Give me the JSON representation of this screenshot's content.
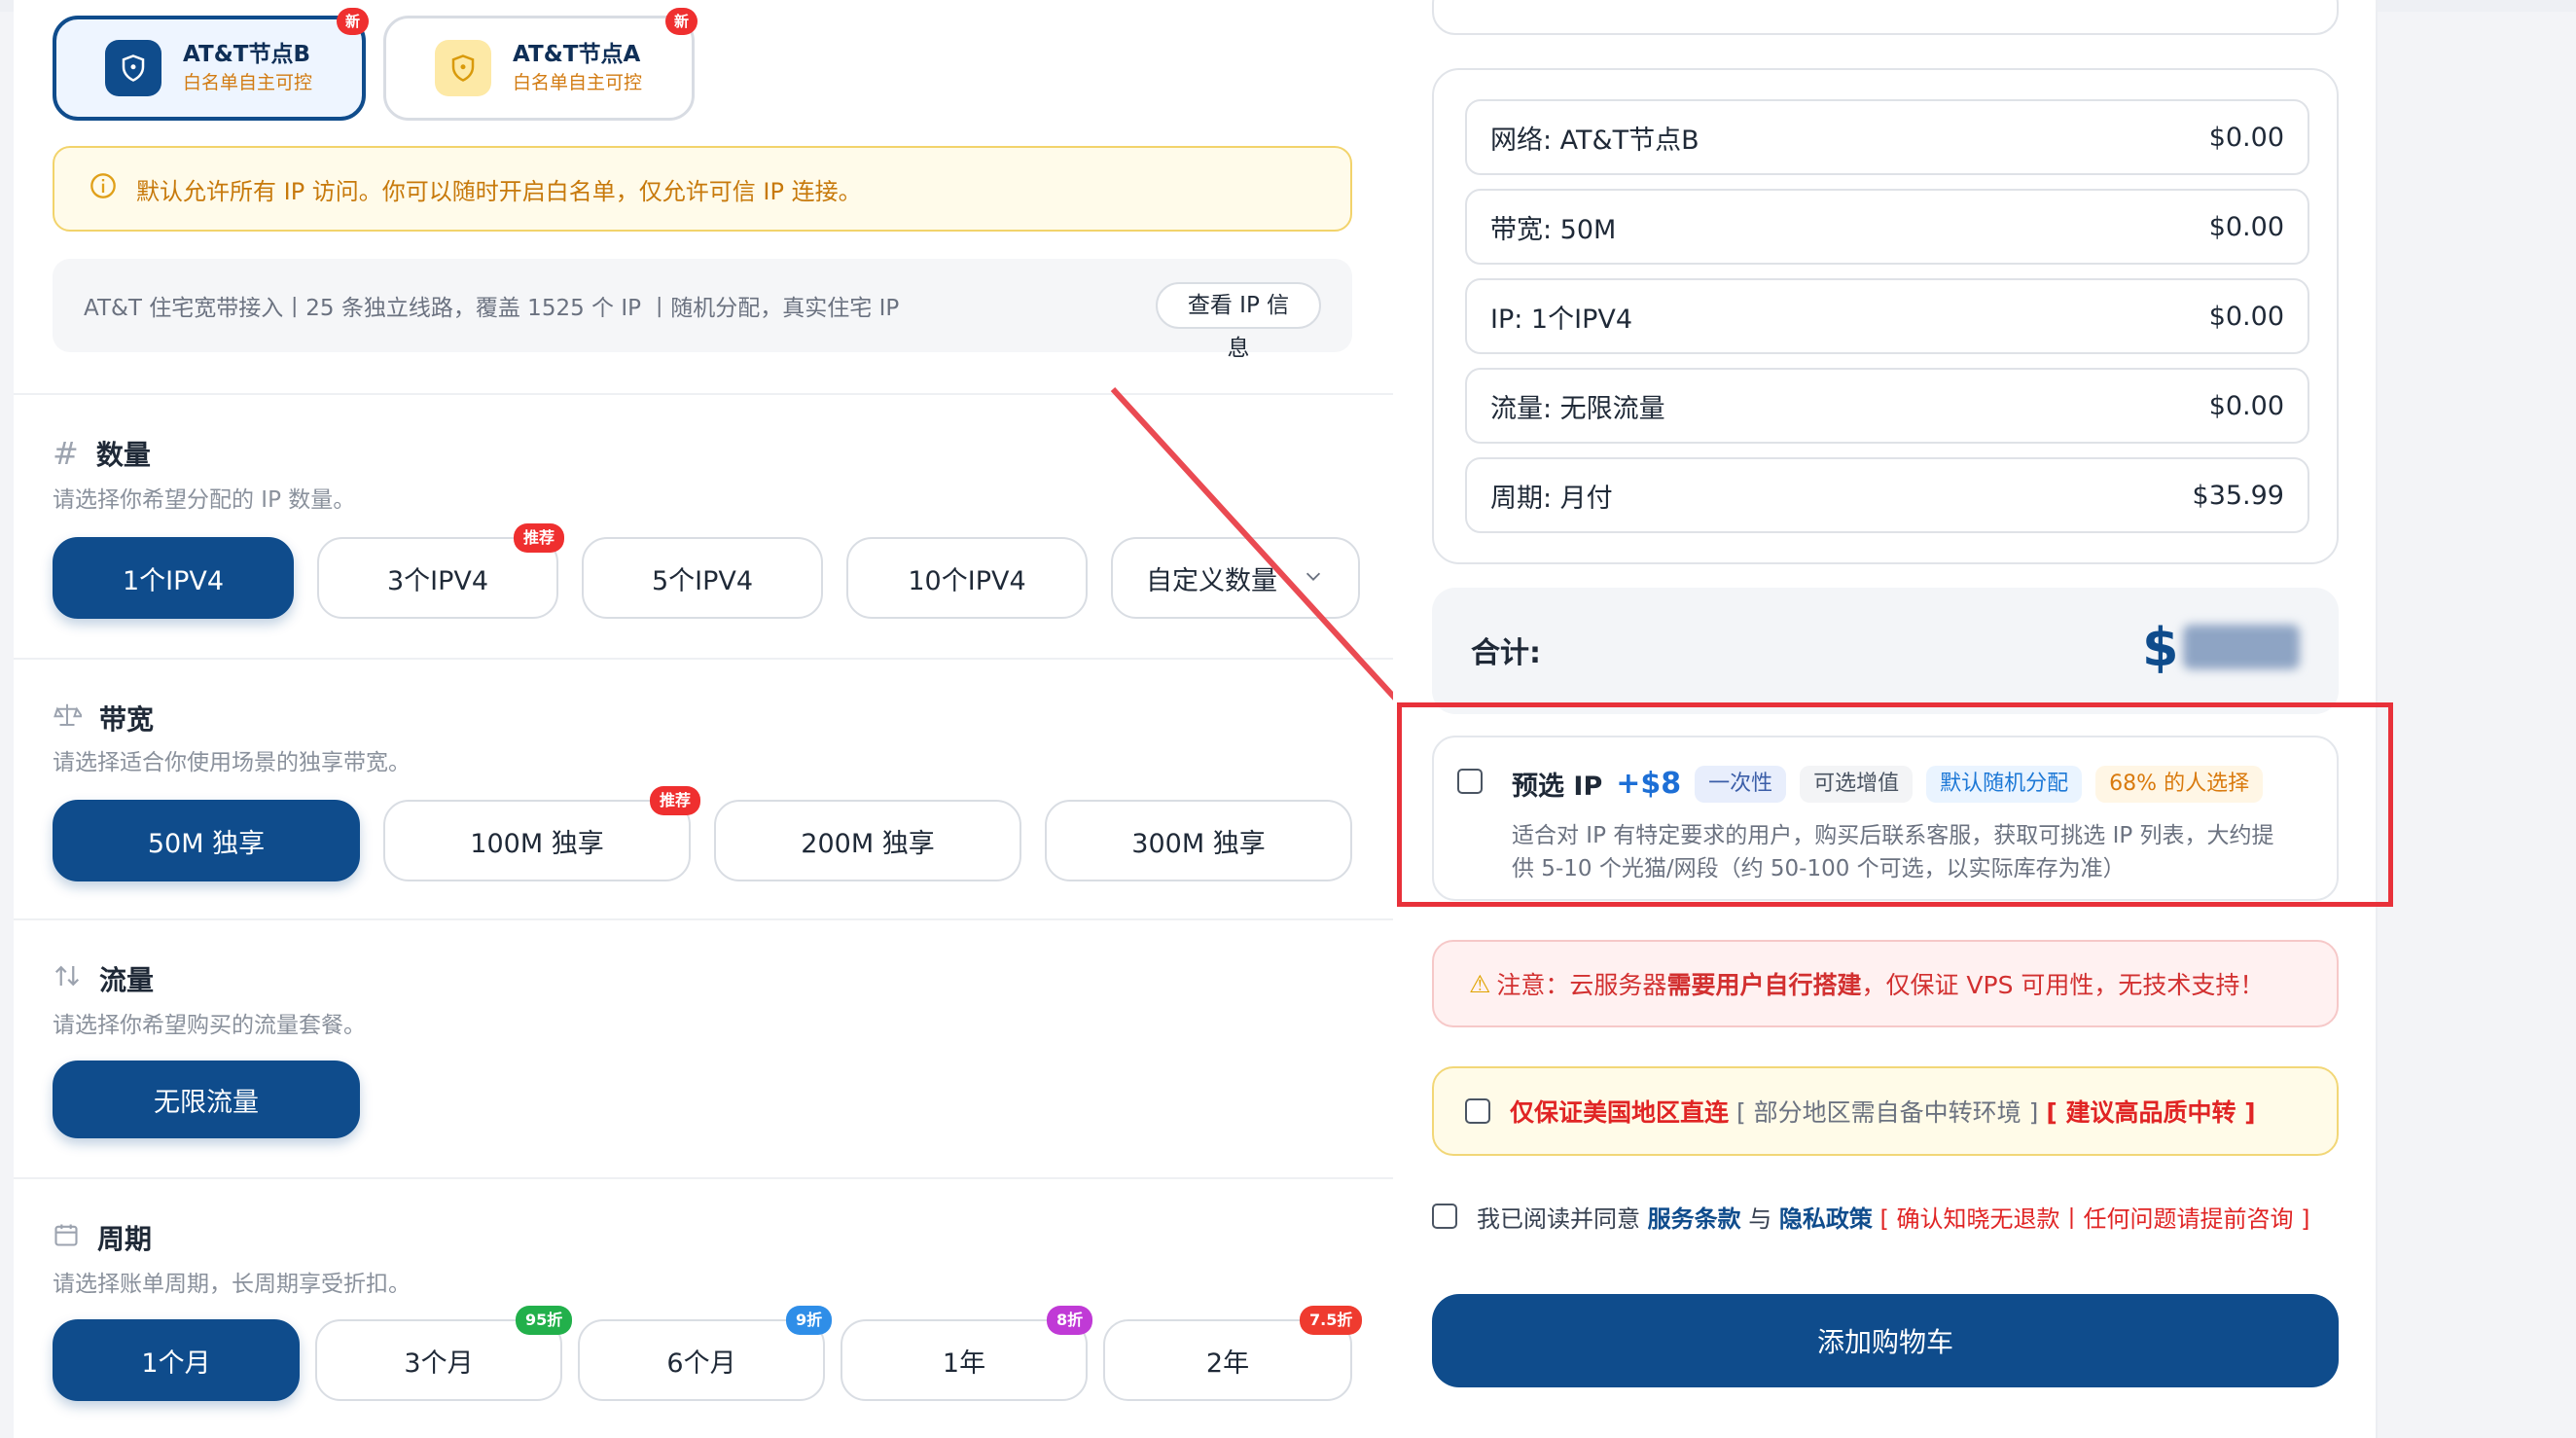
{
  "nodes": [
    {
      "title": "AT&T节点B",
      "subtitle": "白名单自主可控",
      "badge": "新",
      "selected": true
    },
    {
      "title": "AT&T节点A",
      "subtitle": "白名单自主可控",
      "badge": "新",
      "selected": false
    }
  ],
  "notice": "默认允许所有 IP 访问。你可以随时开启白名单，仅允许可信 IP 连接。",
  "info": {
    "text": "AT&T 住宅宽带接入丨25 条独立线路，覆盖 1525 个 IP 丨随机分配，真实住宅 IP",
    "button": "查看 IP 信息"
  },
  "quantity": {
    "icon": "#",
    "title": "数量",
    "desc": "请选择你希望分配的 IP 数量。",
    "options": [
      "1个IPV4",
      "3个IPV4",
      "5个IPV4",
      "10个IPV4"
    ],
    "recommend_badge": "推荐",
    "custom_label": "自定义数量"
  },
  "bandwidth": {
    "title": "带宽",
    "desc": "请选择适合你使用场景的独享带宽。",
    "options": [
      "50M 独享",
      "100M 独享",
      "200M 独享",
      "300M 独享"
    ],
    "recommend_badge": "推荐"
  },
  "traffic": {
    "title": "流量",
    "desc": "请选择你希望购买的流量套餐。",
    "options": [
      "无限流量"
    ]
  },
  "period": {
    "title": "周期",
    "desc": "请选择账单周期，长周期享受折扣。",
    "options": [
      "1个月",
      "3个月",
      "6个月",
      "1年",
      "2年"
    ],
    "discounts": [
      "95折",
      "9折",
      "8折",
      "7.5折"
    ],
    "discount_colors": [
      "#22b04b",
      "#2f8ee8",
      "#c03ad6",
      "#ef3b2f"
    ]
  },
  "summary": {
    "rows": [
      {
        "label": "网络: AT&T节点B",
        "price": "$0.00"
      },
      {
        "label": "带宽: 50M",
        "price": "$0.00"
      },
      {
        "label": "IP: 1个IPV4",
        "price": "$0.00"
      },
      {
        "label": "流量: 无限流量",
        "price": "$0.00"
      },
      {
        "label": "周期: 月付",
        "price": "$35.99"
      }
    ],
    "total_label": "合计:",
    "total_value": "$"
  },
  "preselect": {
    "title": "预选 IP",
    "price": "+$8",
    "chips": [
      "一次性",
      "可选增值",
      "默认随机分配",
      "68% 的人选择"
    ],
    "desc1": "适合对 IP 有特定要求的用户，购买后联系客服，获取可挑选 IP 列表，大约提",
    "desc2": "供 5-10 个光猫/网段（约 50-100 个可选，以实际库存为准）"
  },
  "warning": {
    "icon": "⚠",
    "prefix": "注意：云服务器 ",
    "strong": "需要用户自行搭建",
    "suffix": "，仅保证 VPS 可用性，无技术支持！"
  },
  "us_only": {
    "strong": "仅保证美国地区直连",
    "middle": " [ 部分地区需自备中转环境 ] ",
    "bracket": "[ 建议高品质中转 ]"
  },
  "agree": {
    "prefix": "我已阅读并同意 ",
    "terms": "服务条款",
    "and": " 与 ",
    "privacy": "隐私政策",
    "note": " [ 确认知晓无退款丨任何问题请提前咨询 ]"
  },
  "cart_button": "添加购物车"
}
